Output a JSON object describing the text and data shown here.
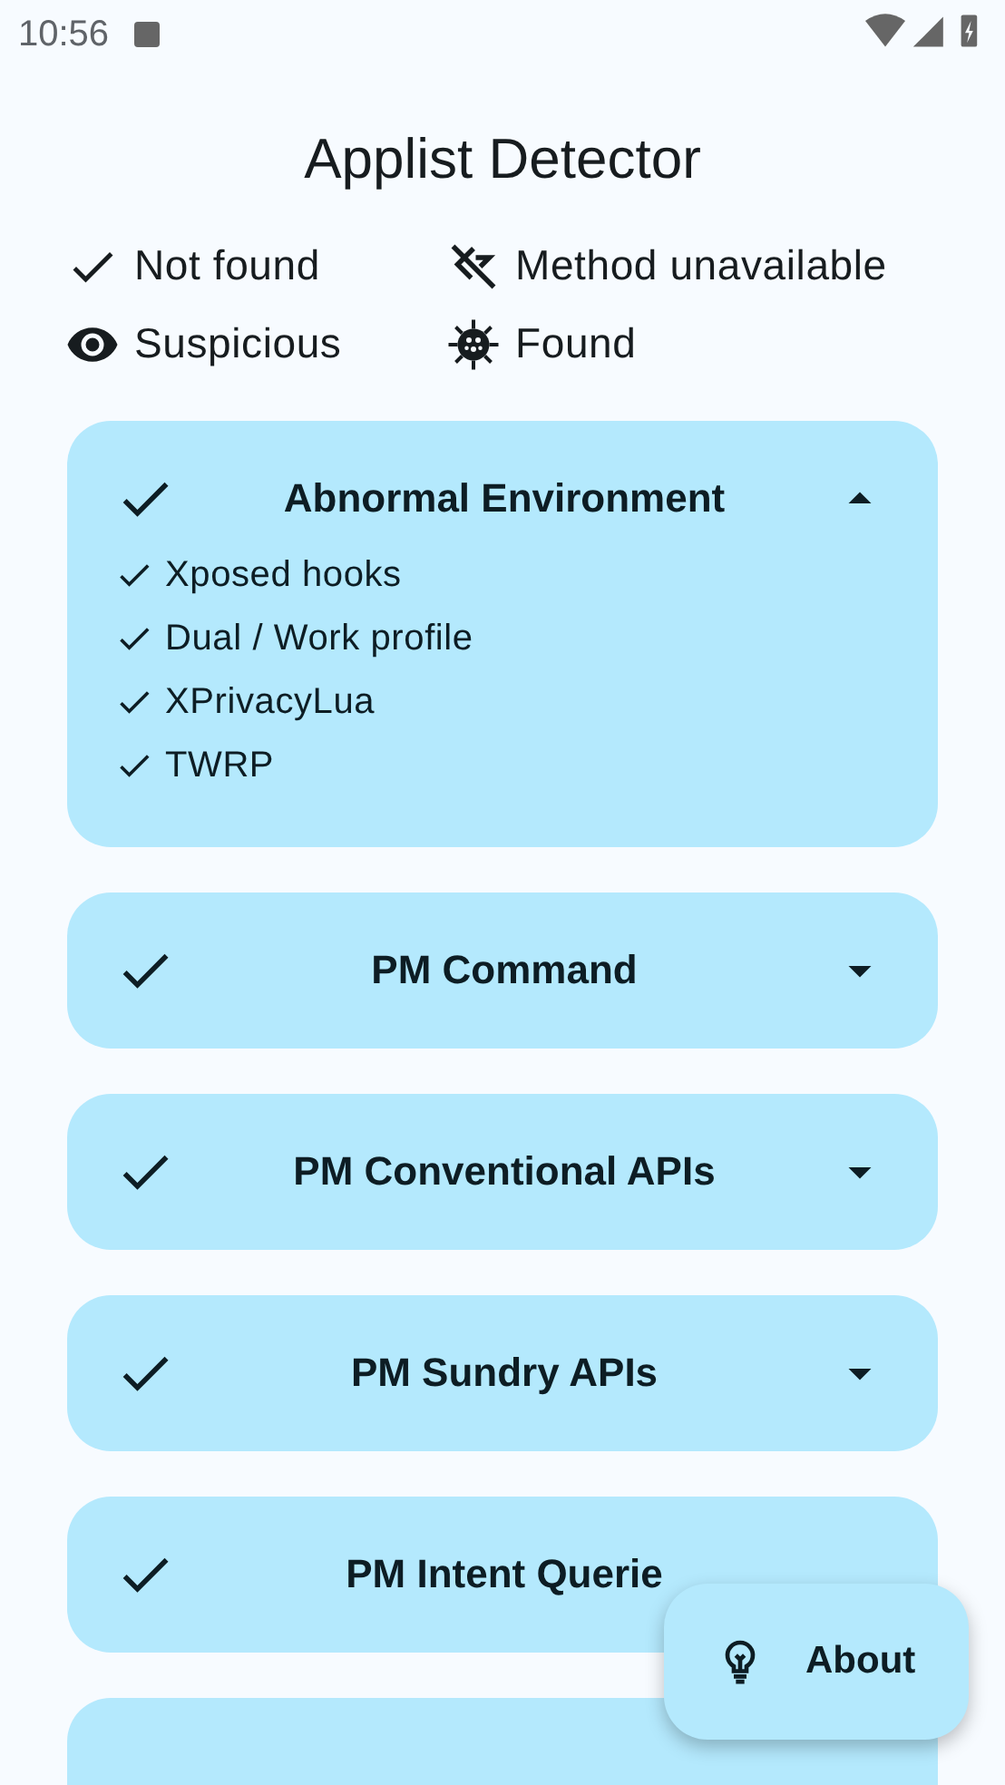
{
  "status_bar": {
    "time": "10:56"
  },
  "title": "Applist Detector",
  "legend": [
    {
      "kind": "not_found",
      "label": "Not found"
    },
    {
      "kind": "unavailable",
      "label": "Method unavailable"
    },
    {
      "kind": "suspicious",
      "label": "Suspicious"
    },
    {
      "kind": "found",
      "label": "Found"
    }
  ],
  "cards": [
    {
      "kind": "not_found",
      "title": "Abnormal Environment",
      "expanded": true,
      "items": [
        {
          "label": "Xposed hooks"
        },
        {
          "label": "Dual / Work profile"
        },
        {
          "label": "XPrivacyLua"
        },
        {
          "label": "TWRP"
        }
      ]
    },
    {
      "kind": "not_found",
      "title": "PM Command",
      "expanded": false
    },
    {
      "kind": "not_found",
      "title": "PM Conventional APIs",
      "expanded": false
    },
    {
      "kind": "not_found",
      "title": "PM Sundry APIs",
      "expanded": false
    },
    {
      "kind": "not_found",
      "title": "PM Intent Querie"
    },
    {
      "kind": "blank"
    }
  ],
  "fab": {
    "label": "About"
  }
}
